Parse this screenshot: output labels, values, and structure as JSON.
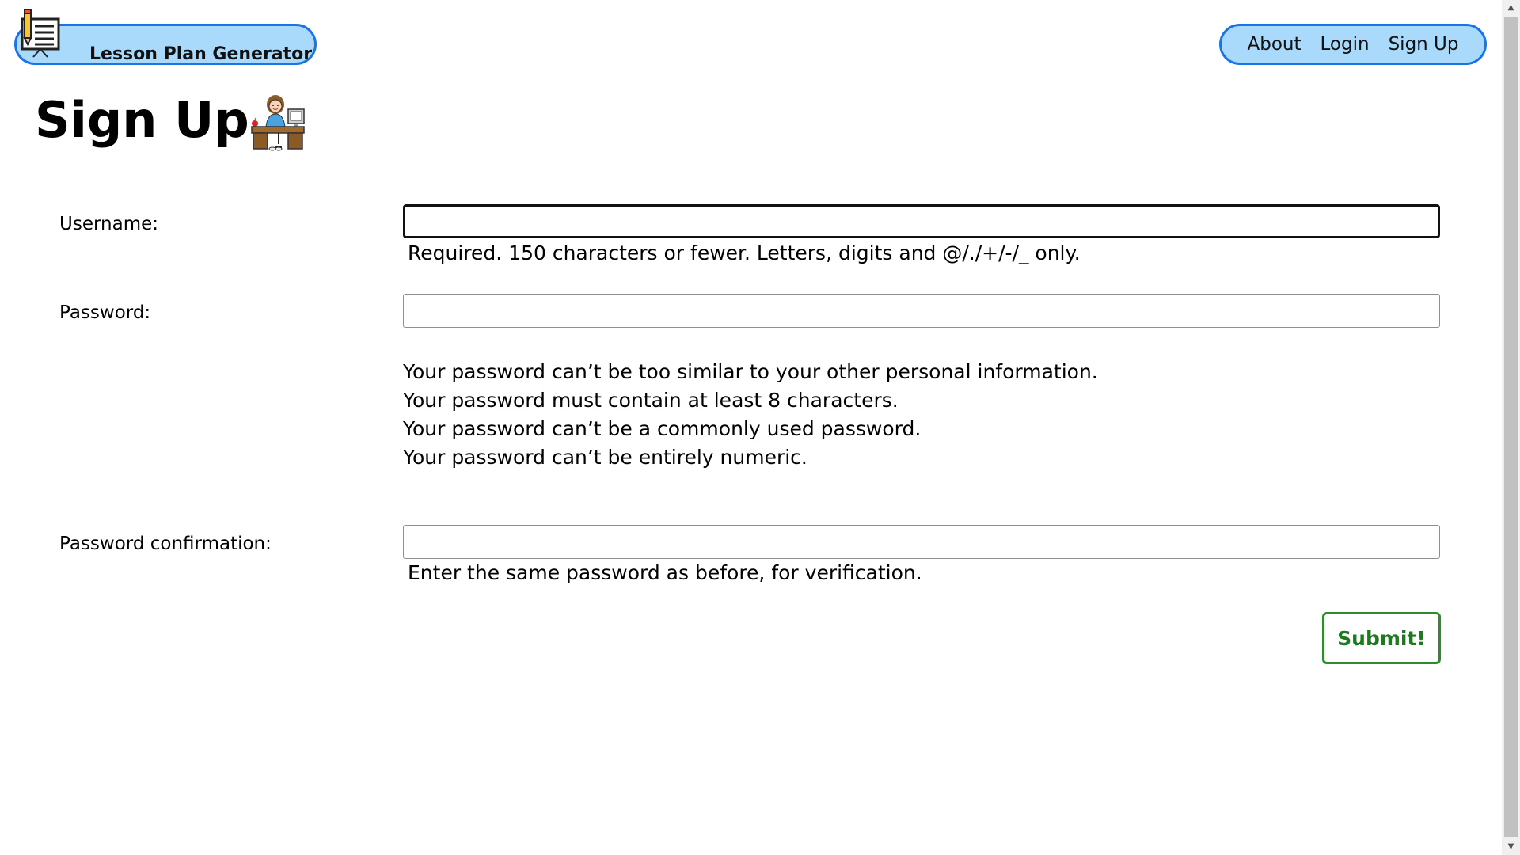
{
  "header": {
    "brand_label": "Lesson Plan Generator",
    "brand_icon": "lesson-board-icon",
    "nav": [
      {
        "label": "About"
      },
      {
        "label": "Login"
      },
      {
        "label": "Sign Up"
      }
    ],
    "accent_color": "#a9d9fb",
    "border_color": "#1a73e8"
  },
  "page": {
    "title": "Sign Up",
    "title_icon": "teacher-at-desk-icon"
  },
  "form": {
    "username": {
      "label": "Username:",
      "value": "",
      "help": "Required. 150 characters or fewer. Letters, digits and @/./+/-/_ only."
    },
    "password": {
      "label": "Password:",
      "value": "",
      "rules": [
        "Your password can’t be too similar to your other personal information.",
        "Your password must contain at least 8 characters.",
        "Your password can’t be a commonly used password.",
        "Your password can’t be entirely numeric."
      ]
    },
    "password_confirmation": {
      "label": "Password confirmation:",
      "value": "",
      "help": "Enter the same password as before, for verification."
    },
    "submit_label": "Submit!",
    "submit_color": "#2e8b2e"
  }
}
